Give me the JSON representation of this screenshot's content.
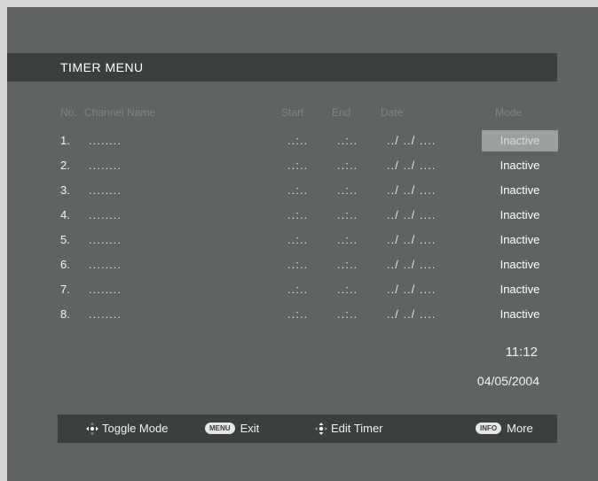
{
  "title": "TIMER MENU",
  "columns": {
    "no": "No.",
    "channel": "Channel Name",
    "start": "Start",
    "end": "End",
    "date": "Date",
    "mode": "Mode"
  },
  "rows": [
    {
      "no": "1.",
      "channel": "........",
      "start": "..:..",
      "end": "..:..",
      "date": "../ ../ ....",
      "mode": "Inactive"
    },
    {
      "no": "2.",
      "channel": "........",
      "start": "..:..",
      "end": "..:..",
      "date": "../ ../ ....",
      "mode": "Inactive"
    },
    {
      "no": "3.",
      "channel": "........",
      "start": "..:..",
      "end": "..:..",
      "date": "../ ../ ....",
      "mode": "Inactive"
    },
    {
      "no": "4.",
      "channel": "........",
      "start": "..:..",
      "end": "..:..",
      "date": "../ ../ ....",
      "mode": "Inactive"
    },
    {
      "no": "5.",
      "channel": "........",
      "start": "..:..",
      "end": "..:..",
      "date": "../ ../ ....",
      "mode": "Inactive"
    },
    {
      "no": "6.",
      "channel": "........",
      "start": "..:..",
      "end": "..:..",
      "date": "../ ../ ....",
      "mode": "Inactive"
    },
    {
      "no": "7.",
      "channel": "........",
      "start": "..:..",
      "end": "..:..",
      "date": "../ ../ ....",
      "mode": "Inactive"
    },
    {
      "no": "8.",
      "channel": "........",
      "start": "..:..",
      "end": "..:..",
      "date": "../ ../ ....",
      "mode": "Inactive"
    }
  ],
  "clock": "11:12",
  "date": "04/05/2004",
  "footer": {
    "toggle_mode": "Toggle Mode",
    "menu_key": "MENU",
    "exit": "Exit",
    "edit_timer": "Edit Timer",
    "info_key": "INFO",
    "more": "More"
  }
}
